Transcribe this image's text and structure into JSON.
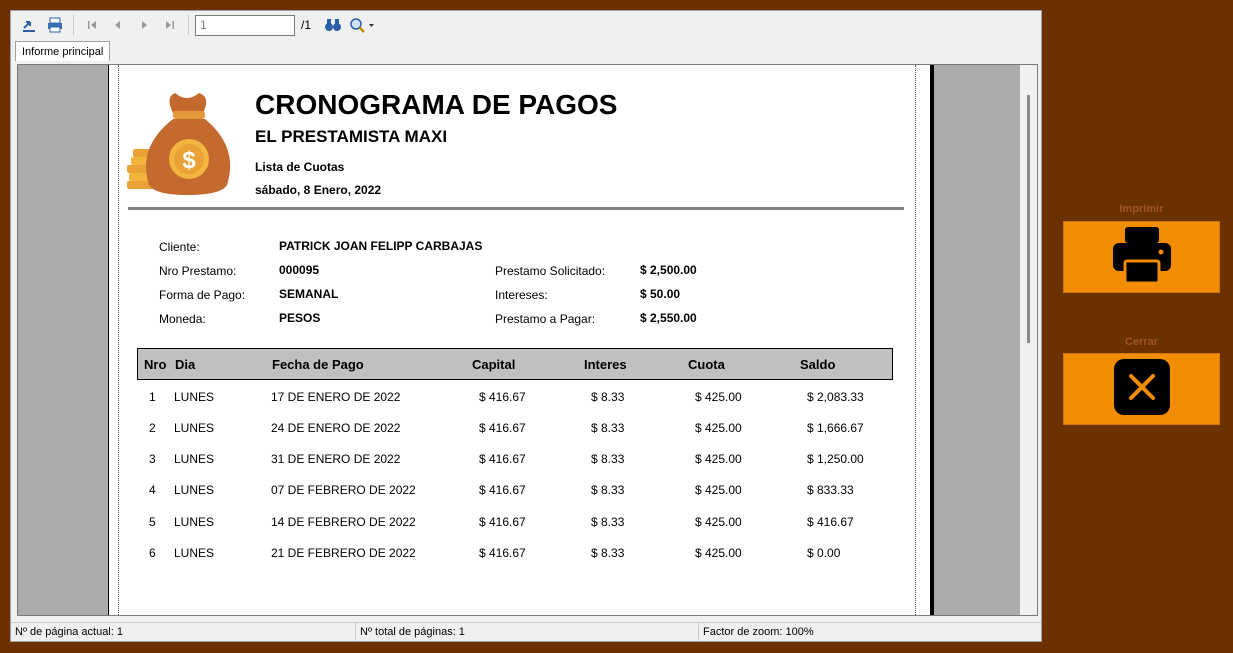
{
  "toolbar": {
    "page_input_value": "1",
    "page_total": "/1",
    "icons": [
      "export-icon",
      "print-icon",
      "first-page-icon",
      "prev-page-icon",
      "next-page-icon",
      "last-page-icon",
      "binoculars-icon",
      "zoom-icon"
    ]
  },
  "tab": {
    "label": "Informe principal"
  },
  "report": {
    "title": "CRONOGRAMA DE PAGOS",
    "subtitle": "EL PRESTAMISTA MAXI",
    "list_label": "Lista de Cuotas",
    "date": "sábado, 8 Enero, 2022",
    "info": {
      "cliente_label": "Cliente:",
      "cliente_value": "PATRICK JOAN FELIPP CARBAJAS",
      "nro_label": "Nro Prestamo:",
      "nro_value": "000095",
      "forma_label": "Forma de Pago:",
      "forma_value": "SEMANAL",
      "moneda_label": "Moneda:",
      "moneda_value": "PESOS",
      "solicitado_label": "Prestamo Solicitado:",
      "solicitado_value": "$ 2,500.00",
      "intereses_label": "Intereses:",
      "intereses_value": "$ 50.00",
      "pagar_label": "Prestamo a Pagar:",
      "pagar_value": "$ 2,550.00"
    },
    "columns": [
      "Nro",
      "Dia",
      "Fecha de Pago",
      "Capital",
      "Interes",
      "Cuota",
      "Saldo"
    ],
    "rows": [
      [
        "1",
        "LUNES",
        "17 DE ENERO DE 2022",
        "$ 416.67",
        "$ 8.33",
        "$ 425.00",
        "$ 2,083.33"
      ],
      [
        "2",
        "LUNES",
        "24 DE ENERO DE 2022",
        "$ 416.67",
        "$ 8.33",
        "$ 425.00",
        "$ 1,666.67"
      ],
      [
        "3",
        "LUNES",
        "31 DE ENERO DE 2022",
        "$ 416.67",
        "$ 8.33",
        "$ 425.00",
        "$ 1,250.00"
      ],
      [
        "4",
        "LUNES",
        "07 DE FEBRERO DE 2022",
        "$ 416.67",
        "$ 8.33",
        "$ 425.00",
        "$ 833.33"
      ],
      [
        "5",
        "LUNES",
        "14 DE FEBRERO DE 2022",
        "$ 416.67",
        "$ 8.33",
        "$ 425.00",
        "$ 416.67"
      ],
      [
        "6",
        "LUNES",
        "21 DE FEBRERO DE 2022",
        "$ 416.67",
        "$ 8.33",
        "$ 425.00",
        "$ 0.00"
      ]
    ]
  },
  "statusbar": {
    "page_current": "Nº de página actual: 1",
    "page_total": "Nº total de páginas: 1",
    "zoom": "Factor de zoom: 100%"
  },
  "actions": {
    "print_label": "Imprimir",
    "close_label": "Cerrar",
    "accent": "#f28c00",
    "background": "#6b3200"
  }
}
